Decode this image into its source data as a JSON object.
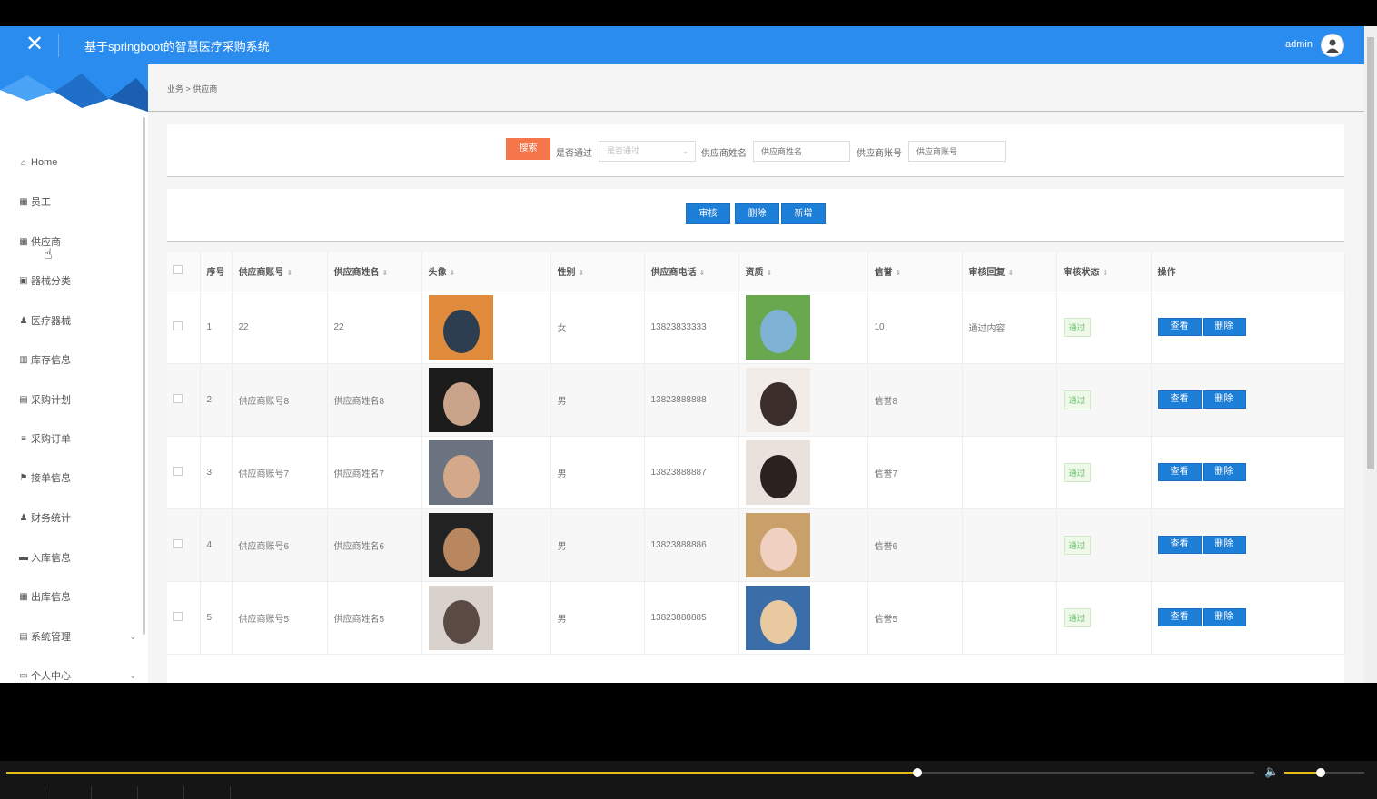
{
  "header": {
    "close_icon": "✕",
    "title": "基于springboot的智慧医疗采购系统",
    "user": "admin",
    "avatar_icon": "user-avatar"
  },
  "sidebar": {
    "items": [
      {
        "label": "Home",
        "icon": "⌂"
      },
      {
        "label": "员工",
        "icon": "▦"
      },
      {
        "label": "供应商",
        "icon": "▦"
      },
      {
        "label": "器械分类",
        "icon": "▣"
      },
      {
        "label": "医疗器械",
        "icon": "♟"
      },
      {
        "label": "库存信息",
        "icon": "▥"
      },
      {
        "label": "采购计划",
        "icon": "▤"
      },
      {
        "label": "采购订单",
        "icon": "≡"
      },
      {
        "label": "接单信息",
        "icon": "⚑"
      },
      {
        "label": "财务统计",
        "icon": "♟"
      },
      {
        "label": "入库信息",
        "icon": "▬"
      },
      {
        "label": "出库信息",
        "icon": "▦"
      },
      {
        "label": "系统管理",
        "icon": "▤",
        "expandable": true
      },
      {
        "label": "个人中心",
        "icon": "▭",
        "expandable": true
      }
    ]
  },
  "breadcrumb": {
    "parent": "业务",
    "sep": ">",
    "current": "供应商"
  },
  "search": {
    "button": "搜索",
    "approved_label": "是否通过",
    "approved_placeholder": "是否通过",
    "name_label": "供应商姓名",
    "name_placeholder": "供应商姓名",
    "account_label": "供应商账号",
    "account_placeholder": "供应商账号"
  },
  "actions": {
    "audit": "审核",
    "delete": "删除",
    "add": "新增"
  },
  "table": {
    "headers": [
      "序号",
      "供应商账号",
      "供应商姓名",
      "头像",
      "性别",
      "供应商电话",
      "资质",
      "信誉",
      "审核回复",
      "审核状态",
      "操作"
    ],
    "rows": [
      {
        "no": "1",
        "account": "22",
        "name": "22",
        "gender": "女",
        "phone": "13823833333",
        "credit": "10",
        "reply": "通过内容",
        "status": "通过"
      },
      {
        "no": "2",
        "account": "供应商账号8",
        "name": "供应商姓名8",
        "gender": "男",
        "phone": "13823888888",
        "credit": "信誉8",
        "reply": "",
        "status": "通过"
      },
      {
        "no": "3",
        "account": "供应商账号7",
        "name": "供应商姓名7",
        "gender": "男",
        "phone": "13823888887",
        "credit": "信誉7",
        "reply": "",
        "status": "通过"
      },
      {
        "no": "4",
        "account": "供应商账号6",
        "name": "供应商姓名6",
        "gender": "男",
        "phone": "13823888886",
        "credit": "信誉6",
        "reply": "",
        "status": "通过"
      },
      {
        "no": "5",
        "account": "供应商账号5",
        "name": "供应商姓名5",
        "gender": "男",
        "phone": "13823888885",
        "credit": "信誉5",
        "reply": "",
        "status": "通过"
      }
    ],
    "view_btn": "查看",
    "delete_btn": "删除"
  },
  "player": {
    "progress": 0.73,
    "volume": 0.45,
    "accent": "#e8b814"
  }
}
